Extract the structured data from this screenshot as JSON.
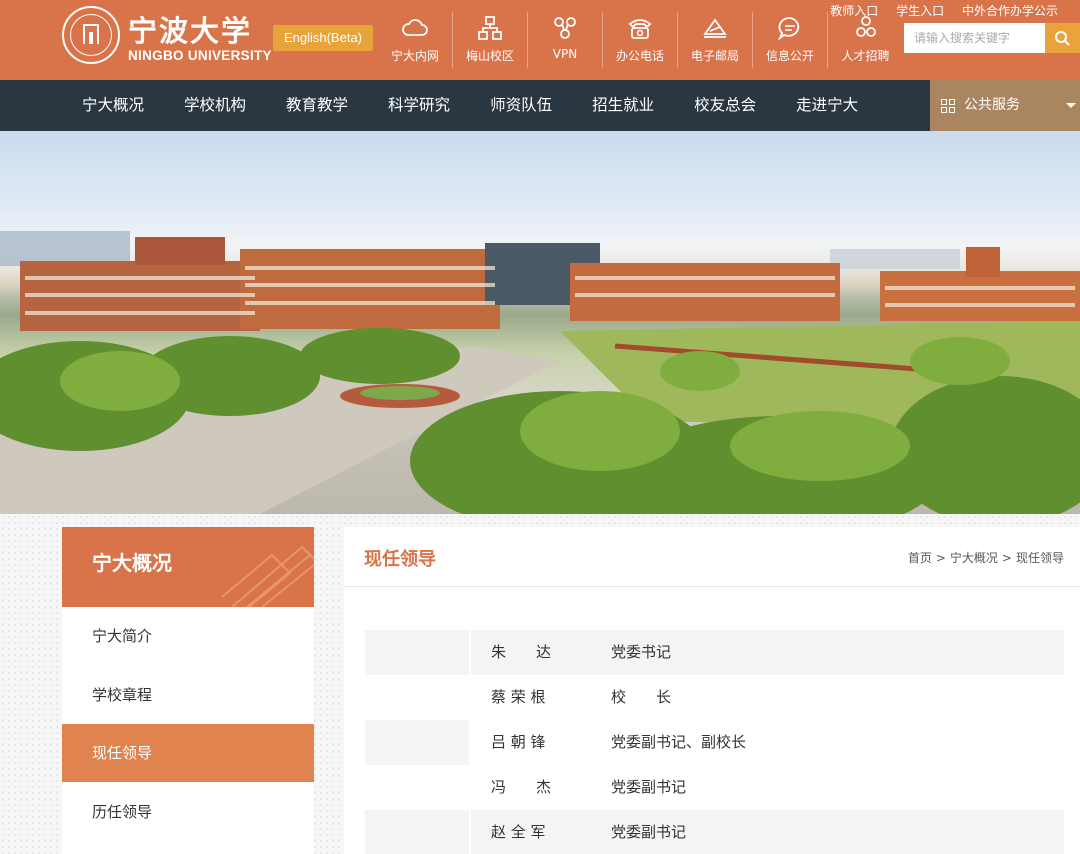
{
  "header": {
    "logo_cn": "宁波大学",
    "logo_en": "NINGBO UNIVERSITY",
    "english_label": "English(Beta)",
    "quick_links": [
      {
        "label": "宁大内网",
        "icon": "cloud-icon"
      },
      {
        "label": "梅山校区",
        "icon": "campus-network-icon"
      },
      {
        "label": "VPN",
        "icon": "vpn-icon"
      },
      {
        "label": "办公电话",
        "icon": "phone-icon"
      },
      {
        "label": "电子邮局",
        "icon": "mail-icon"
      },
      {
        "label": "信息公开",
        "icon": "chat-bubble-icon"
      },
      {
        "label": "人才招聘",
        "icon": "people-icon"
      }
    ],
    "portal_links": [
      "教师入口",
      "学生入口",
      "中外合作办学公示"
    ],
    "search": {
      "placeholder": "请输入搜索关键字"
    }
  },
  "nav": {
    "items": [
      "宁大概况",
      "学校机构",
      "教育教学",
      "科学研究",
      "师资队伍",
      "招生就业",
      "校友总会",
      "走进宁大"
    ],
    "public_service": "公共服务"
  },
  "sidebar": {
    "title": "宁大概况",
    "items": [
      "宁大简介",
      "学校章程",
      "现任领导",
      "历任领导"
    ],
    "active_index": 2
  },
  "main": {
    "title": "现任领导",
    "breadcrumb": [
      "首页",
      "宁大概况",
      "现任领导"
    ],
    "breadcrumb_sep": ">",
    "leaders": [
      {
        "name": "朱　　达",
        "title": "党委书记"
      },
      {
        "name": "蔡 荣 根",
        "title": "校　　长"
      },
      {
        "name": "吕 朝 锋",
        "title": "党委副书记、副校长"
      },
      {
        "name": "冯　　杰",
        "title": "党委副书记"
      },
      {
        "name": "赵 全 军",
        "title": "党委副书记"
      }
    ]
  },
  "colors": {
    "brand_orange": "#d9744a",
    "accent_gold": "#e8a33a",
    "nav_dark": "#2a3640",
    "public_service_bg": "#a98560"
  }
}
